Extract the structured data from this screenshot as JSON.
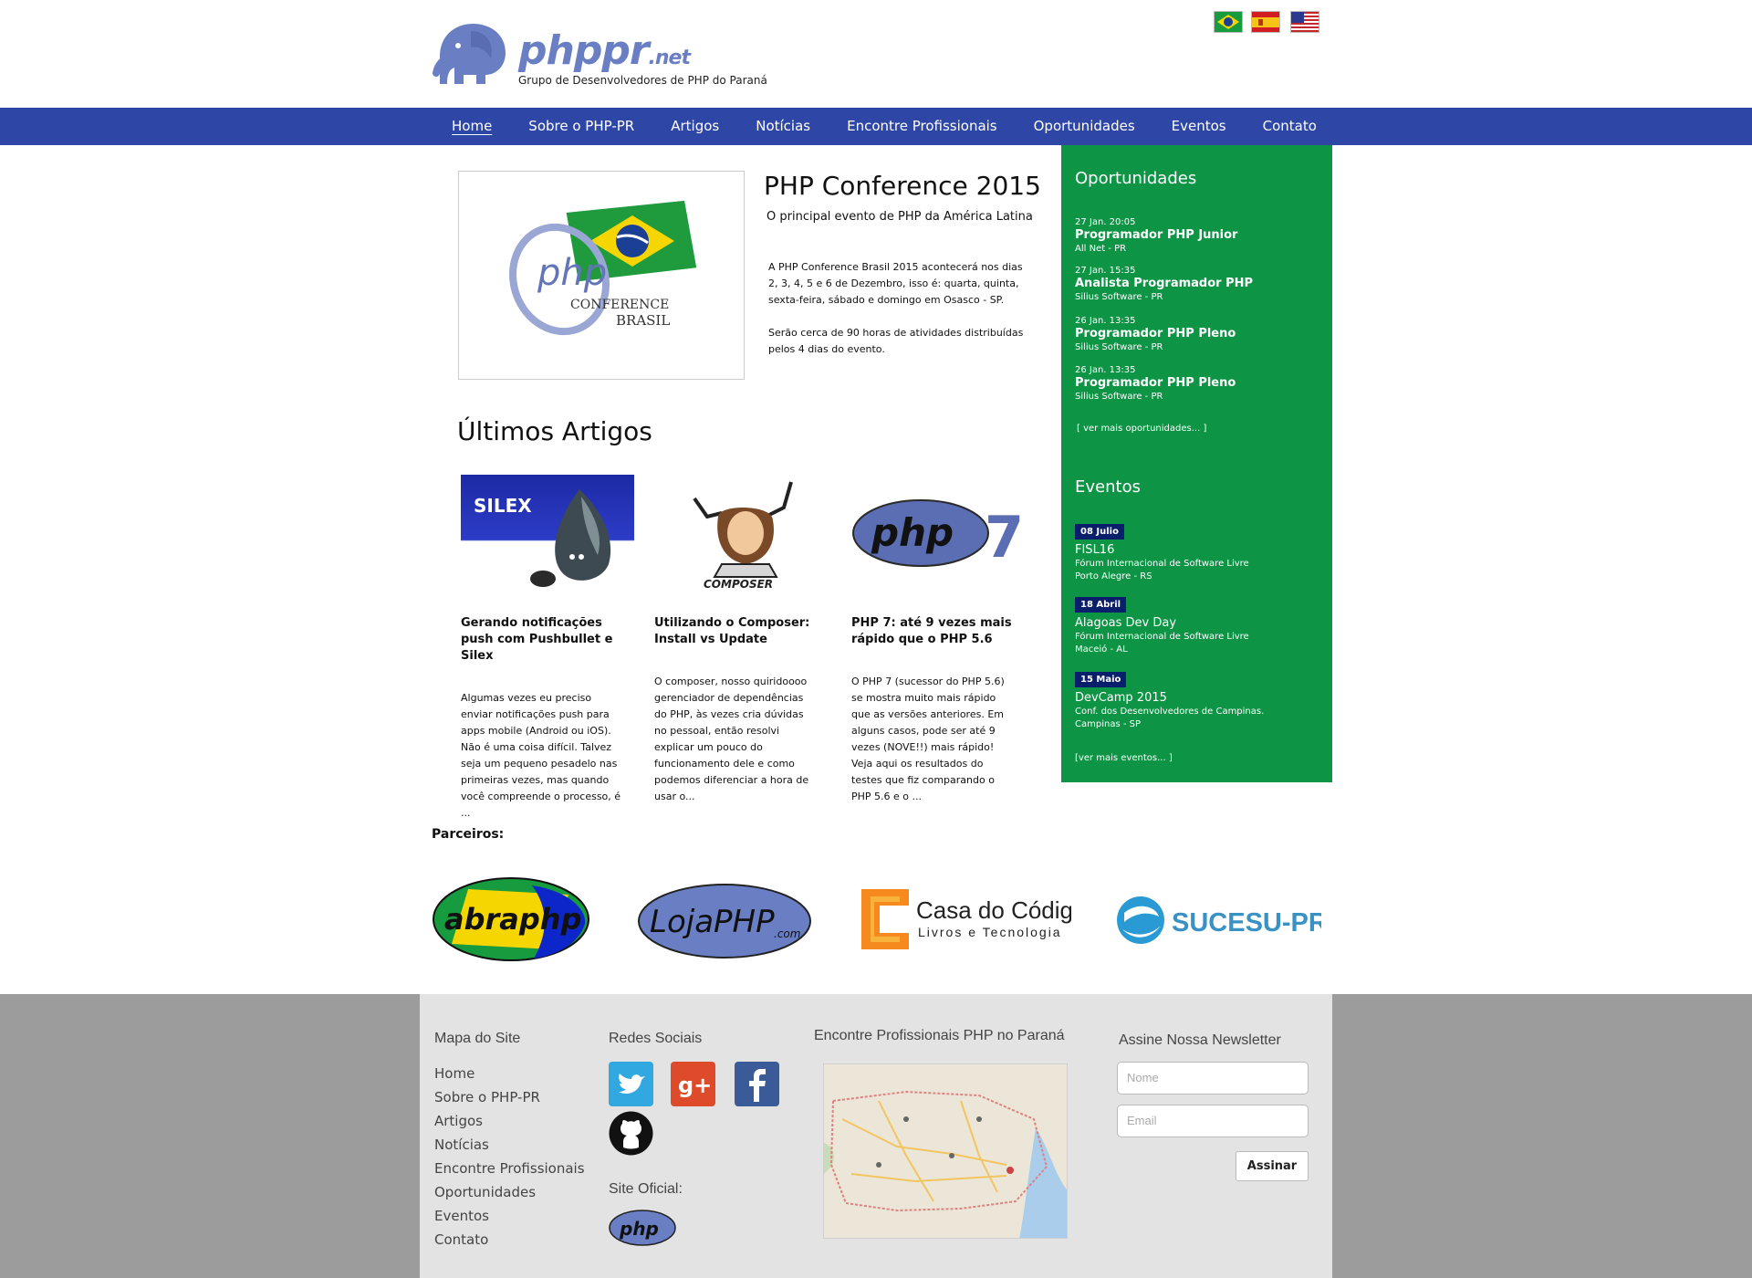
{
  "header": {
    "logo_name": "phppr",
    "logo_tld": ".net",
    "logo_tagline": "Grupo de Desenvolvedores de PHP do Paraná",
    "flags": [
      "brazil-flag",
      "spain-flag",
      "usa-flag"
    ]
  },
  "nav": {
    "items": [
      "Home",
      "Sobre o PHP-PR",
      "Artigos",
      "Notícias",
      "Encontre Profissionais",
      "Oportunidades",
      "Eventos",
      "Contato"
    ],
    "active": "Home"
  },
  "featured": {
    "image_text_php": "php",
    "image_text_conference": "CONFERENCE",
    "image_text_brasil": "BRASIL",
    "title": "PHP Conference 2015",
    "subtitle": "O principal evento de PHP da América Latina",
    "paragraph1": "A PHP Conference Brasil 2015 acontecerá nos dias 2, 3, 4, 5 e 6 de Dezembro, isso é: quarta, quinta, sexta-feira, sábado e domingo em Osasco - SP.",
    "paragraph2": "Serão cerca de 90 horas de atividades distribuídas pelos 4 dias do evento."
  },
  "articles": {
    "heading": "Últimos Artigos",
    "items": [
      {
        "thumb_text": "SILEX",
        "title": "Gerando notificações push com Pushbullet e Silex",
        "excerpt": "Algumas vezes eu preciso enviar notificações push para apps mobile (Android ou iOS). Não é uma coisa difícil. Talvez seja um pequeno pesadelo nas primeiras vezes, mas quando você compreende o processo, é ..."
      },
      {
        "thumb_text": "COMPOSER",
        "title": "Utilizando o Composer: Install vs Update",
        "excerpt": "O composer, nosso quiridoooo gerenciador de dependências do PHP, às vezes cria dúvidas no pessoal, então resolvi explicar um pouco do funcionamento dele e como podemos diferenciar a hora de usar o..."
      },
      {
        "thumb_text": "php",
        "thumb_number": "7",
        "title": "PHP 7: até 9 vezes mais rápido que o PHP 5.6",
        "excerpt": "O PHP 7 (sucessor do PHP 5.6) se mostra muito mais rápido que as versões anteriores. Em alguns casos, pode ser até 9 vezes (NOVE!!) mais rápido! Veja aqui os resultados do testes que fiz comparando o PHP 5.6 e o ..."
      }
    ]
  },
  "sidebar": {
    "opportunities_heading": "Oportunidades",
    "opportunities": [
      {
        "date": "27 Jan. 20:05",
        "title": "Programador PHP Junior",
        "company": "All Net - PR"
      },
      {
        "date": "27 Jan. 15:35",
        "title": "Analista Programador PHP",
        "company": "Silius Software  - PR"
      },
      {
        "date": "26 Jan. 13:35",
        "title": "Programador PHP Pleno",
        "company": "Silius Software  - PR"
      },
      {
        "date": "26 Jan. 13:35",
        "title": "Programador PHP Pleno",
        "company": "Silius Software  - PR"
      }
    ],
    "opportunities_more": "[ ver mais oportunidades... ]",
    "events_heading": "Eventos",
    "events": [
      {
        "date": "08 Julio",
        "title": "FISL16",
        "line1": "Fórum Internacional de Software Livre",
        "line2": "Porto Alegre - RS"
      },
      {
        "date": "18 Abril",
        "title": "Alagoas Dev Day",
        "line1": "Fórum Internacional de Software Livre",
        "line2": "Maceió - AL"
      },
      {
        "date": "15 Maio",
        "title": "DevCamp 2015",
        "line1": "Conf. dos Desenvolvedores de Campinas.",
        "line2": "Campinas - SP"
      }
    ],
    "events_more": "[ver mais eventos... ]"
  },
  "partners": {
    "heading": "Parceiros:",
    "abraphp": "abraphp",
    "lojaphp": "LojaPHP",
    "lojaphp_suffix": ".com",
    "casa_title": "Casa do Código",
    "casa_sub": "Livros e Tecnologia",
    "sucesu": "SUCESU-PR"
  },
  "footer": {
    "sitemap_heading": "Mapa do Site",
    "sitemap_links": [
      "Home",
      "Sobre o PHP-PR",
      "Artigos",
      "Notícias",
      "Encontre Profissionais",
      "Oportunidades",
      "Eventos",
      "Contato"
    ],
    "social_heading": "Redes Sociais",
    "social_icons": [
      "twitter-icon",
      "google-plus-icon",
      "facebook-icon",
      "github-icon"
    ],
    "official_heading": "Site Oficial:",
    "official_logo": "php",
    "map_heading": "Encontre Profissionais PHP no Paraná",
    "newsletter_heading": "Assine Nossa Newsletter",
    "name_placeholder": "Nome",
    "email_placeholder": "Email",
    "subscribe_label": "Assinar"
  },
  "colors": {
    "nav": "#2e47a6",
    "sidebar": "#0d9445",
    "badge": "#0a1f6b",
    "footer_bg": "#9c9c9c",
    "footer_panel": "#e3e3e3"
  }
}
